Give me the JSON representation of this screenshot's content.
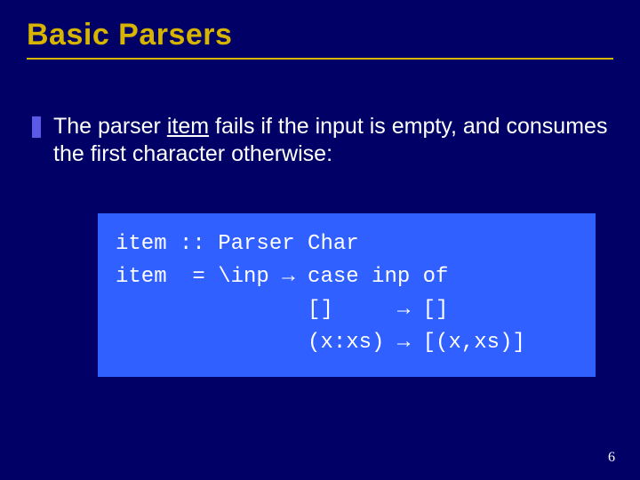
{
  "title": "Basic Parsers",
  "bullet": {
    "pre": "The parser ",
    "underlined": "item",
    "post": " fails if the input is empty, and consumes the first character otherwise:"
  },
  "code": {
    "line1": "item :: Parser Char",
    "line2": "item  = \\inp → case inp of",
    "line3": "               []     → []",
    "line4": "               (x:xs) → [(x,xs)]"
  },
  "page": "6"
}
